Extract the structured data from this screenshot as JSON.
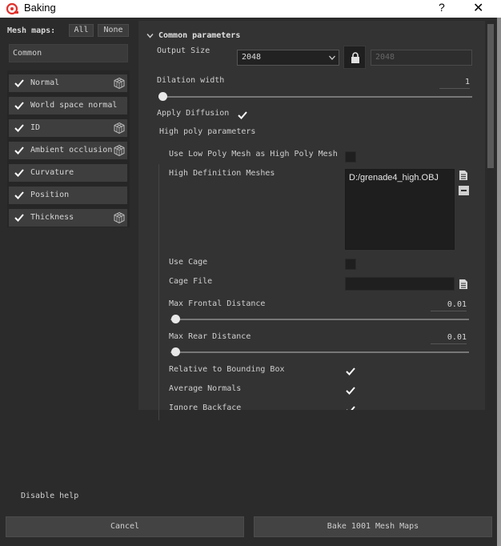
{
  "window": {
    "title": "Baking",
    "help_label": "?",
    "close_label": "✕"
  },
  "left": {
    "mesh_maps_label": "Mesh maps:",
    "all_label": "All",
    "none_label": "None",
    "common_label": "Common",
    "maps": [
      {
        "label": "Normal",
        "checked": true,
        "has_cube": true
      },
      {
        "label": "World space normal",
        "checked": true,
        "has_cube": false
      },
      {
        "label": "ID",
        "checked": true,
        "has_cube": true
      },
      {
        "label": "Ambient occlusion",
        "checked": true,
        "has_cube": true
      },
      {
        "label": "Curvature",
        "checked": true,
        "has_cube": false
      },
      {
        "label": "Position",
        "checked": true,
        "has_cube": false
      },
      {
        "label": "Thickness",
        "checked": true,
        "has_cube": true
      }
    ]
  },
  "params": {
    "section_title": "Common parameters",
    "output_size_label": "Output Size",
    "output_size_value": "2048",
    "output_size_locked_value": "2048",
    "dilation_label": "Dilation width",
    "dilation_value": "1",
    "apply_diffusion_label": "Apply Diffusion",
    "high_poly_title": "High poly parameters",
    "use_low_poly_label": "Use Low Poly Mesh as High Poly Mesh",
    "high_def_meshes_label": "High Definition Meshes",
    "high_def_meshes_value": "D:/grenade4_high.OBJ",
    "use_cage_label": "Use Cage",
    "cage_file_label": "Cage File",
    "max_frontal_label": "Max Frontal Distance",
    "max_frontal_value": "0.01",
    "max_rear_label": "Max Rear Distance",
    "max_rear_value": "0.01",
    "relative_bbox_label": "Relative to Bounding Box",
    "average_normals_label": "Average Normals",
    "ignore_backface_label": "Ignore Backface"
  },
  "footer": {
    "disable_help_label": "Disable help",
    "cancel_label": "Cancel",
    "bake_label": "Bake 1001 Mesh Maps"
  },
  "colors": {
    "accent_check": "#ffffff",
    "panel": "#333333",
    "background": "#2b2b2b"
  }
}
